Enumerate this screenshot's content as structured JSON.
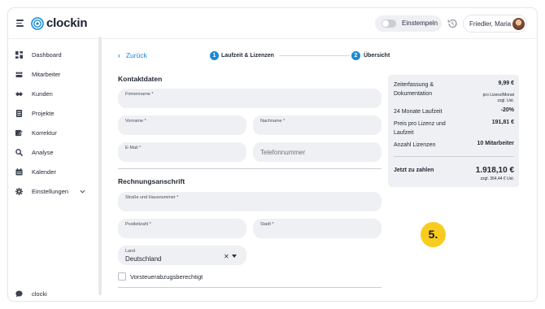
{
  "app": {
    "logo_text": "clockin"
  },
  "header": {
    "clockin_label": "Einstempeln",
    "user_name": "Friedler, Maria"
  },
  "sidebar": {
    "items": [
      {
        "label": "Dashboard",
        "icon": "dashboard-icon"
      },
      {
        "label": "Mitarbeiter",
        "icon": "employees-icon"
      },
      {
        "label": "Kunden",
        "icon": "customers-icon"
      },
      {
        "label": "Projekte",
        "icon": "projects-icon"
      },
      {
        "label": "Korrektur",
        "icon": "correction-icon"
      },
      {
        "label": "Analyse",
        "icon": "analysis-icon"
      },
      {
        "label": "Kalender",
        "icon": "calendar-icon"
      },
      {
        "label": "Einstellungen",
        "icon": "settings-icon"
      }
    ],
    "bottom_item": {
      "label": "clocki",
      "icon": "chat-icon"
    }
  },
  "nav": {
    "back_label": "Zurück",
    "steps": [
      {
        "number": "1",
        "label": "Laufzeit & Lizenzen"
      },
      {
        "number": "2",
        "label": "Übersicht"
      }
    ]
  },
  "contact": {
    "title": "Kontaktdaten",
    "company_label": "Firmenname *",
    "firstname_label": "Vorname *",
    "lastname_label": "Nachname *",
    "email_label": "E-Mail *",
    "phone_placeholder": "Telefonnummer"
  },
  "billing": {
    "title": "Rechnungsanschrift",
    "street_label": "Straße und Hausnummer *",
    "zip_label": "Postleitzahl *",
    "city_label": "Stadt *",
    "country_label": "Land",
    "country_value": "Deutschland",
    "clear_symbol": "✕",
    "vat_checkbox_label": "Vorsteuerabzugsberechtigt"
  },
  "summary": {
    "rows": [
      {
        "label": "Zeiterfassung & Dokumentation",
        "value": "9,99 €",
        "sub": "pro Lizenz/Monat zzgl. Ust."
      },
      {
        "label": "24 Monate Laufzeit",
        "value": "-20%"
      },
      {
        "label": "Preis pro Lizenz und Laufzeit",
        "value": "191,81 €"
      },
      {
        "label": "Anzahl Lizenzen",
        "value": "10 Mitarbeiter"
      }
    ],
    "total_label": "Jetzt zu zahlen",
    "total_value": "1.918,10 €",
    "total_sub": "zzgl. 364,44 € Ust."
  },
  "annotation": {
    "badge": "5."
  },
  "colors": {
    "accent": "#1a8ad4",
    "field_bg": "#eef0f3",
    "badge": "#f7cc1e"
  }
}
